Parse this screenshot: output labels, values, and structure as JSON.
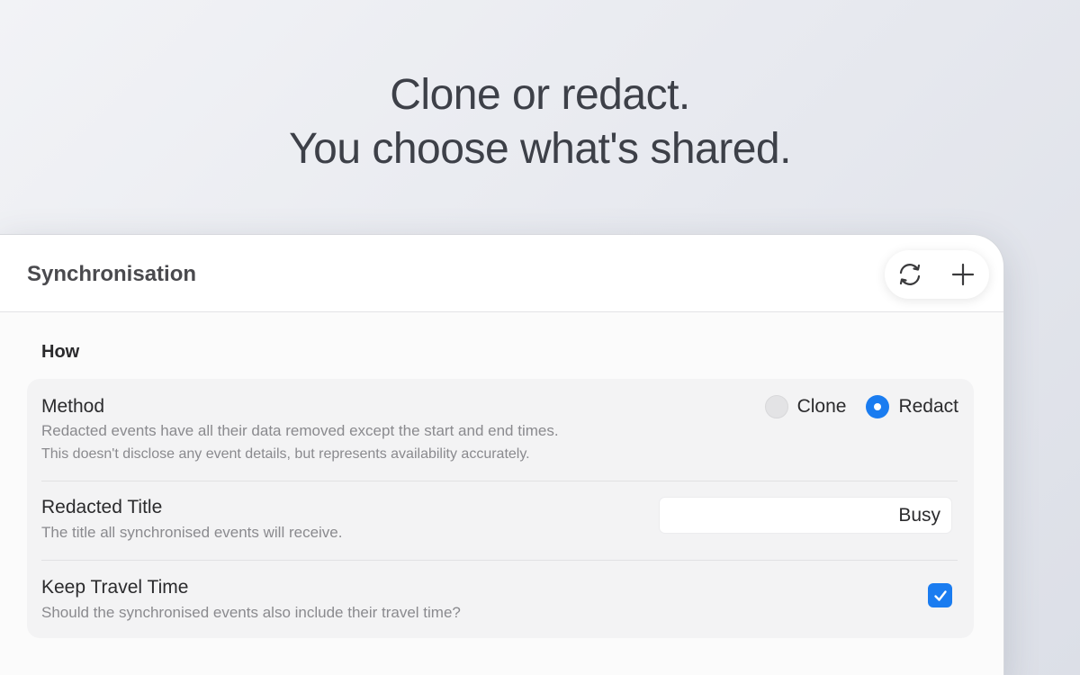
{
  "headline": {
    "line1": "Clone or redact.",
    "line2": "You choose what's shared."
  },
  "window": {
    "title": "Synchronisation",
    "toolbar": {
      "sync_icon": "sync-icon",
      "add_icon": "plus-icon"
    }
  },
  "section": {
    "title": "How"
  },
  "method": {
    "label": "Method",
    "description_1": "Redacted events have all their data removed except the start and end times.",
    "description_2": "This doesn't disclose any event details, but represents availability accurately.",
    "options": [
      "Clone",
      "Redact"
    ],
    "selected": "Redact"
  },
  "redacted_title": {
    "label": "Redacted Title",
    "description": "The title all synchronised events will receive.",
    "value": "Busy"
  },
  "keep_travel_time": {
    "label": "Keep Travel Time",
    "description": "Should the synchronised events also include their travel time?",
    "checked": true
  },
  "colors": {
    "accent": "#1a7cf0",
    "headline_text": "#3d4048"
  }
}
